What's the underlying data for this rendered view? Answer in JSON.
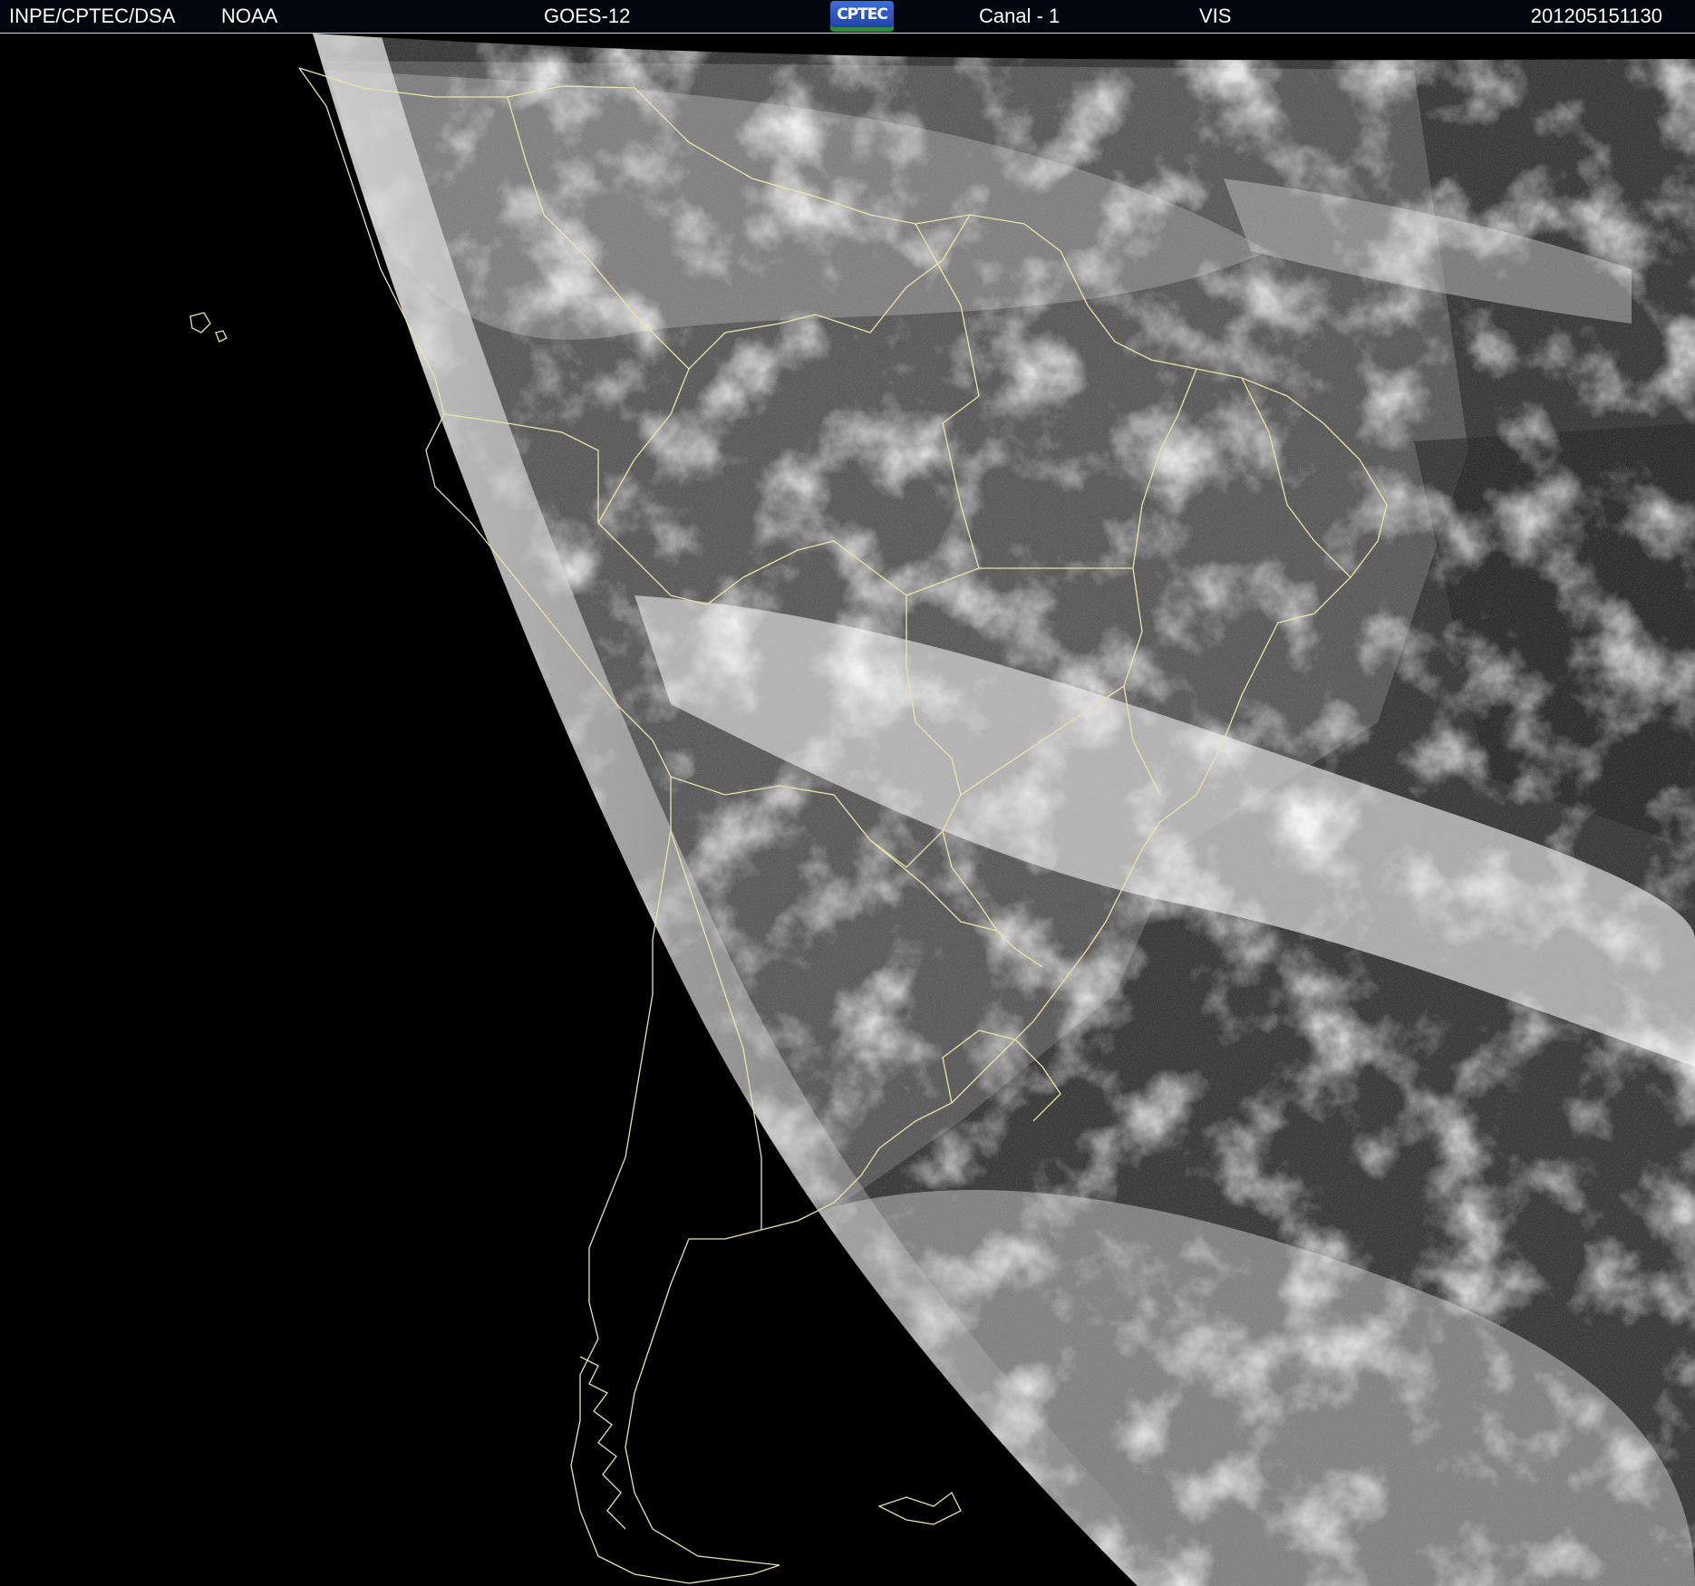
{
  "header": {
    "org": "INPE/CPTEC/DSA",
    "agency": "NOAA",
    "satellite": "GOES-12",
    "logo_text": "CPTEC",
    "channel": "Canal - 1",
    "band": "VIS",
    "timestamp": "201205151130"
  },
  "colors": {
    "background": "#000000",
    "header_bg": "#04060f",
    "header_text": "#ffffff",
    "border_lines": "#e8e6a8",
    "cloud_bright": "#f2f2f2",
    "land_grey": "#6d6d6d",
    "ocean_dark": "#2e2e2e"
  },
  "icons": {
    "logo": "cptec-logo"
  }
}
